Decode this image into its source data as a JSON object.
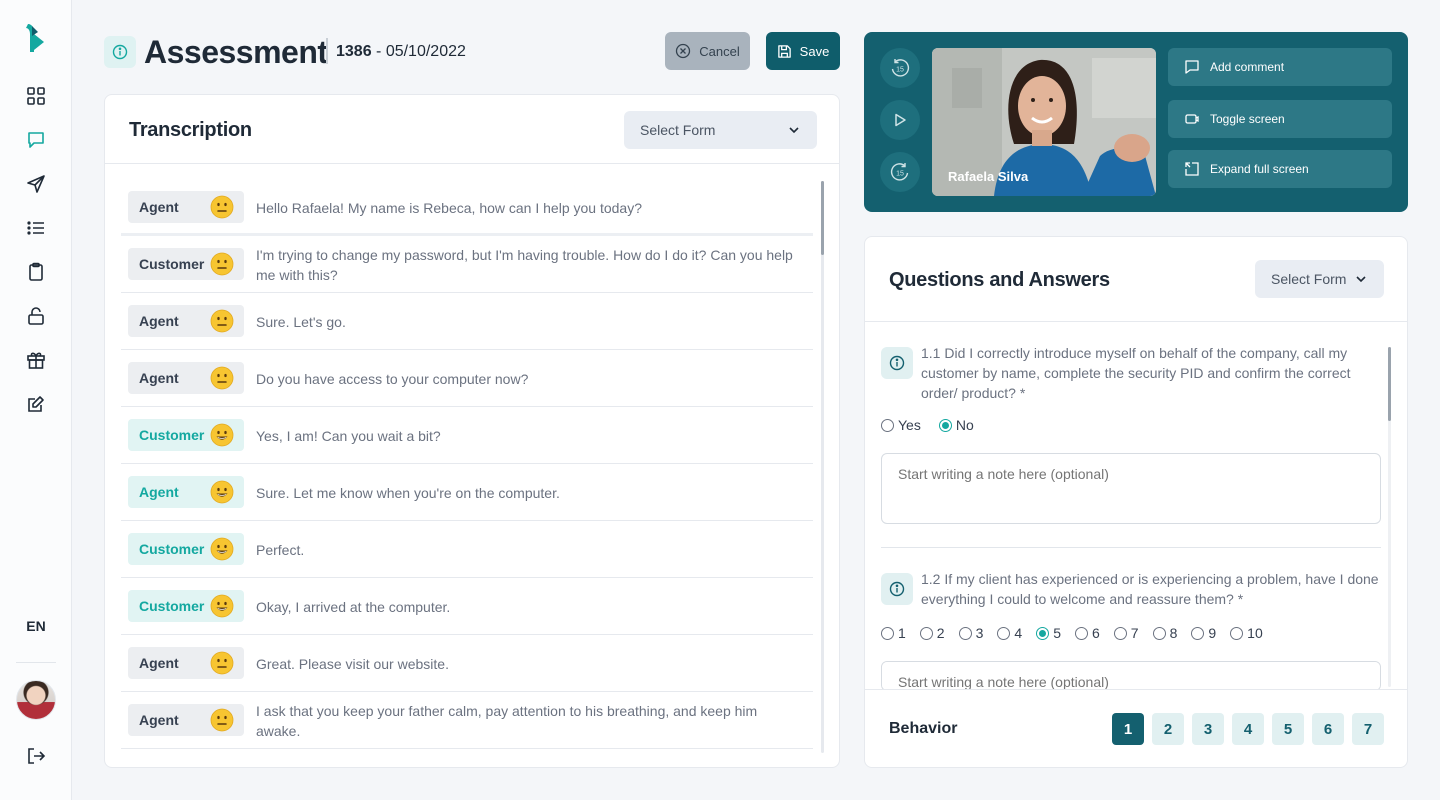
{
  "sidebar": {
    "language": "EN",
    "items": [
      {
        "icon": "dashboard-grid-icon"
      },
      {
        "icon": "chat-icon",
        "active": true
      },
      {
        "icon": "send-icon"
      },
      {
        "icon": "list-icon"
      },
      {
        "icon": "clipboard-icon"
      },
      {
        "icon": "unlock-icon"
      },
      {
        "icon": "gift-icon"
      },
      {
        "icon": "edit-icon"
      }
    ]
  },
  "header": {
    "title": "Assessment",
    "id": "1386",
    "date": " - 05/10/2022",
    "cancel_label": "Cancel",
    "save_label": "Save"
  },
  "transcription": {
    "title": "Transcription",
    "select_form_label": "Select Form",
    "messages": [
      {
        "speaker": "Agent",
        "mood": "neutral",
        "text": "Hello Rafaela! My name is Rebeca, how can I help you today?"
      },
      {
        "speaker": "Customer",
        "mood": "neutral",
        "text": "I'm trying to change my password, but I'm having trouble. How do I do it? Can you help me with this?"
      },
      {
        "speaker": "Agent",
        "mood": "neutral",
        "text": "Sure. Let's go."
      },
      {
        "speaker": "Agent",
        "mood": "neutral",
        "text": "Do you have access to your computer now?"
      },
      {
        "speaker": "Customer",
        "mood": "happy",
        "text": "Yes, I am! Can you wait a bit?"
      },
      {
        "speaker": "Agent",
        "mood": "happy",
        "text": "Sure. Let me know when you're on the computer."
      },
      {
        "speaker": "Customer",
        "mood": "happy",
        "text": "Perfect."
      },
      {
        "speaker": "Customer",
        "mood": "happy",
        "text": "Okay, I arrived at the computer."
      },
      {
        "speaker": "Agent",
        "mood": "neutral",
        "text": "Great. Please visit our website."
      },
      {
        "speaker": "Agent",
        "mood": "neutral",
        "text": "I ask that you keep your father calm, pay attention to his breathing, and keep him awake."
      }
    ]
  },
  "video": {
    "participant_name": "Rafaela Silva",
    "rewind_label": "15",
    "forward_label": "15",
    "actions": {
      "add_comment": "Add comment",
      "toggle_screen": "Toggle screen",
      "expand_full_screen": "Expand full screen"
    }
  },
  "qa": {
    "title": "Questions and Answers",
    "select_form_label": "Select Form",
    "q1": {
      "text": "1.1 Did I correctly introduce myself on behalf of the company, call my customer by name, complete the security PID and confirm the correct order/ product? *",
      "options": [
        "Yes",
        "No"
      ],
      "selected": "No",
      "note_placeholder": "Start writing a note here (optional)"
    },
    "q2": {
      "text": "1.2 If my client has experienced or is experiencing a problem, have I done everything I could to welcome and reassure them? *",
      "options": [
        "1",
        "2",
        "3",
        "4",
        "5",
        "6",
        "7",
        "8",
        "9",
        "10"
      ],
      "selected": "5",
      "note_placeholder": "Start writing a note here (optional)"
    },
    "footer": {
      "section_label": "Behavior",
      "pages": [
        "1",
        "2",
        "3",
        "4",
        "5",
        "6",
        "7"
      ],
      "active_page": "1"
    }
  },
  "colors": {
    "brand": "#14606f",
    "accent": "#14a8a0",
    "cancel_bg": "#a9b3bd"
  }
}
